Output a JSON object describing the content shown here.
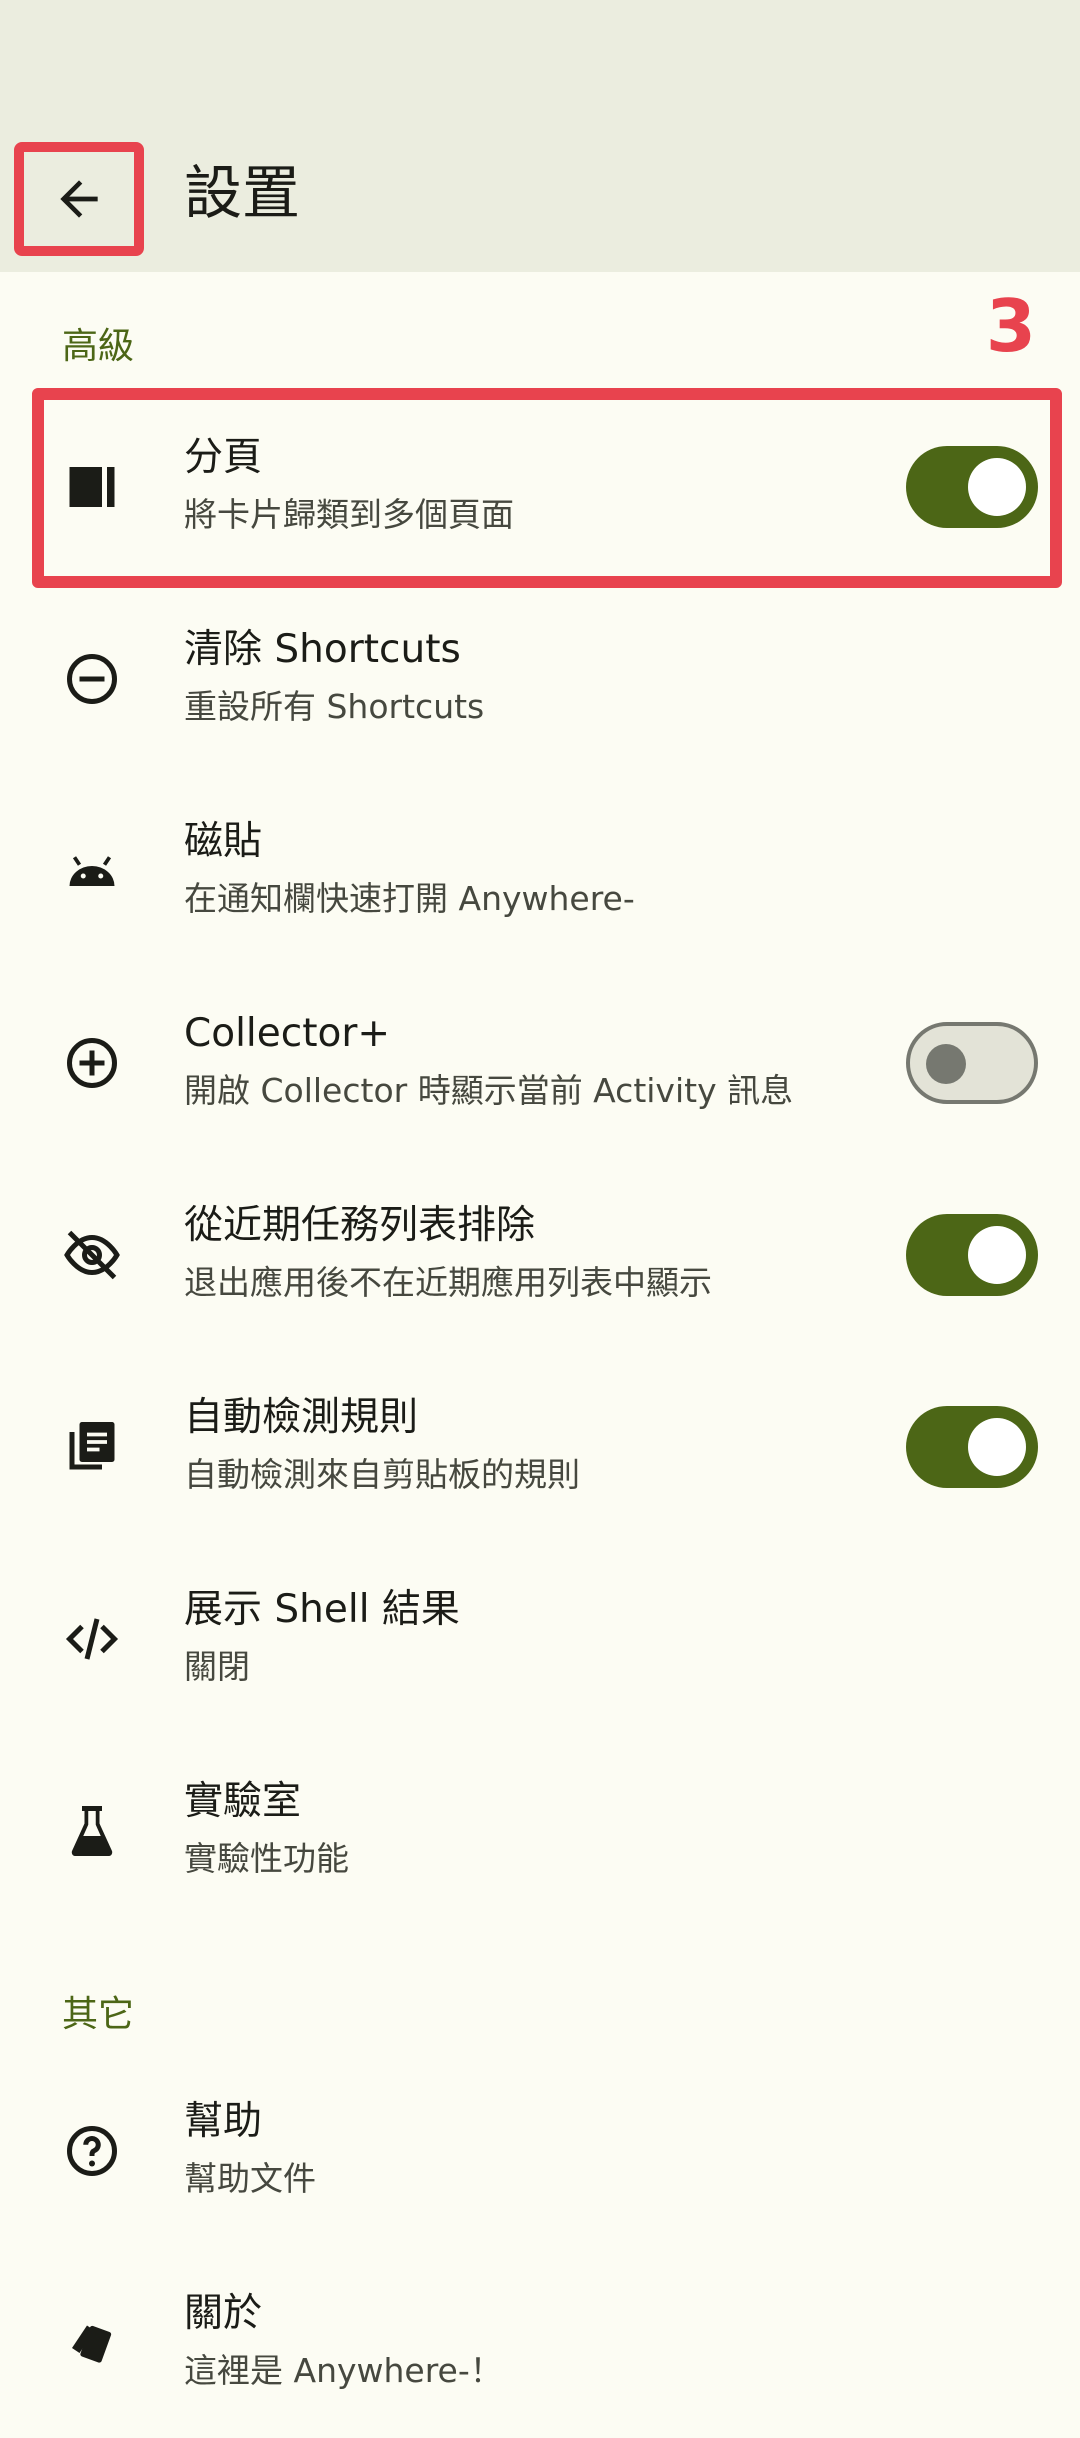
{
  "header": {
    "title": "設置"
  },
  "annotation": {
    "number": "3"
  },
  "sections": {
    "advanced": "高級",
    "other": "其它"
  },
  "items": {
    "pages": {
      "title": "分頁",
      "subtitle": "將卡片歸類到多個頁面",
      "icon": "tab-page-icon",
      "switch": "on"
    },
    "clear_shortcuts": {
      "title": "清除 Shortcuts",
      "subtitle": "重設所有 Shortcuts",
      "icon": "minus-circle-icon"
    },
    "tiles": {
      "title": "磁貼",
      "subtitle": "在通知欄快速打開 Anywhere-",
      "icon": "android-icon"
    },
    "collector": {
      "title": "Collector+",
      "subtitle": "開啟 Collector 時顯示當前 Activity 訊息",
      "icon": "plus-circle-icon",
      "switch": "off"
    },
    "exclude_recents": {
      "title": "從近期任務列表排除",
      "subtitle": "退出應用後不在近期應用列表中顯示",
      "icon": "eye-off-icon",
      "switch": "on"
    },
    "auto_detect": {
      "title": "自動檢測規則",
      "subtitle": "自動檢測來自剪貼板的規則",
      "icon": "documents-icon",
      "switch": "on"
    },
    "shell_result": {
      "title": "展示 Shell 結果",
      "subtitle": "關閉",
      "icon": "code-icon"
    },
    "lab": {
      "title": "實驗室",
      "subtitle": "實驗性功能",
      "icon": "flask-icon"
    },
    "help": {
      "title": "幫助",
      "subtitle": "幫助文件",
      "icon": "help-circle-icon"
    },
    "about": {
      "title": "關於",
      "subtitle": "這裡是 Anywhere-！",
      "icon": "cards-icon"
    }
  },
  "colors": {
    "appbar": "#EBEDDF",
    "background": "#FCFCF3",
    "accent": "#4C6616",
    "annotation": "#E8434E"
  }
}
